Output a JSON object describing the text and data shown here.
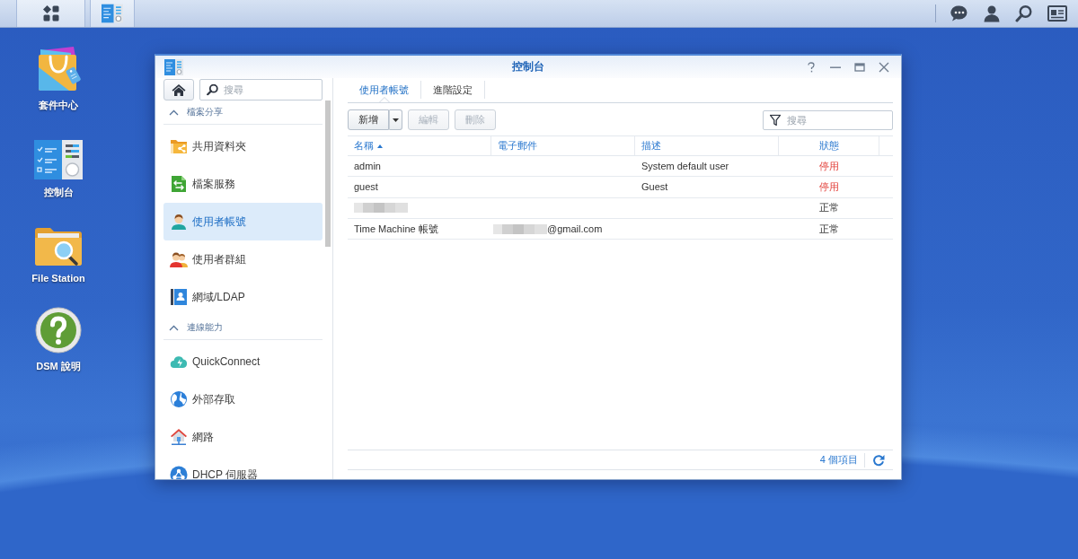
{
  "desktop": {
    "shortcuts": [
      {
        "label": "套件中心",
        "kind": "package-center"
      },
      {
        "label": "控制台",
        "kind": "control-panel"
      },
      {
        "label": "File Station",
        "kind": "file-station"
      },
      {
        "label": "DSM 說明",
        "kind": "help"
      }
    ]
  },
  "window": {
    "title": "控制台",
    "sidebar": {
      "search": {
        "placeholder": "搜尋"
      },
      "sections": [
        {
          "title": "檔案分享",
          "expanded": true,
          "items": [
            {
              "label": "共用資料夾",
              "kind": "shared-folder",
              "selected": false
            },
            {
              "label": "檔案服務",
              "kind": "file-services",
              "selected": false
            },
            {
              "label": "使用者帳號",
              "kind": "user",
              "selected": true
            },
            {
              "label": "使用者群組",
              "kind": "group",
              "selected": false
            },
            {
              "label": "網域/LDAP",
              "kind": "domain",
              "selected": false
            }
          ]
        },
        {
          "title": "連線能力",
          "expanded": true,
          "items": [
            {
              "label": "QuickConnect",
              "kind": "quickconnect",
              "selected": false
            },
            {
              "label": "外部存取",
              "kind": "external-access",
              "selected": false
            },
            {
              "label": "網路",
              "kind": "network",
              "selected": false
            },
            {
              "label": "DHCP 伺服器",
              "kind": "dhcp",
              "selected": false
            }
          ]
        }
      ]
    },
    "tabs": [
      {
        "label": "使用者帳號",
        "selected": true
      },
      {
        "label": "進階設定",
        "selected": false
      }
    ],
    "toolbar": {
      "buttons": [
        {
          "label": "新增",
          "disabled": false,
          "dropdown": true
        },
        {
          "label": "編輯",
          "disabled": true,
          "dropdown": false
        },
        {
          "label": "刪除",
          "disabled": true,
          "dropdown": false
        }
      ],
      "search": {
        "placeholder": "搜尋"
      }
    },
    "table": {
      "columns": [
        {
          "label": "名稱",
          "sorted": true
        },
        {
          "label": "電子郵件"
        },
        {
          "label": "描述"
        },
        {
          "label": "狀態"
        }
      ],
      "rows": [
        {
          "name": "admin",
          "description": "System default user",
          "status": "停用",
          "enabled": false
        },
        {
          "name": "guest",
          "description": "Guest",
          "status": "停用",
          "enabled": false
        },
        {
          "name_redacted": true,
          "status": "正常",
          "enabled": true
        },
        {
          "name": "Time Machine 帳號",
          "email": "@gmail.com",
          "email_redacted": true,
          "status": "正常",
          "enabled": true
        }
      ]
    },
    "footer": {
      "count": "4 個項目"
    }
  }
}
